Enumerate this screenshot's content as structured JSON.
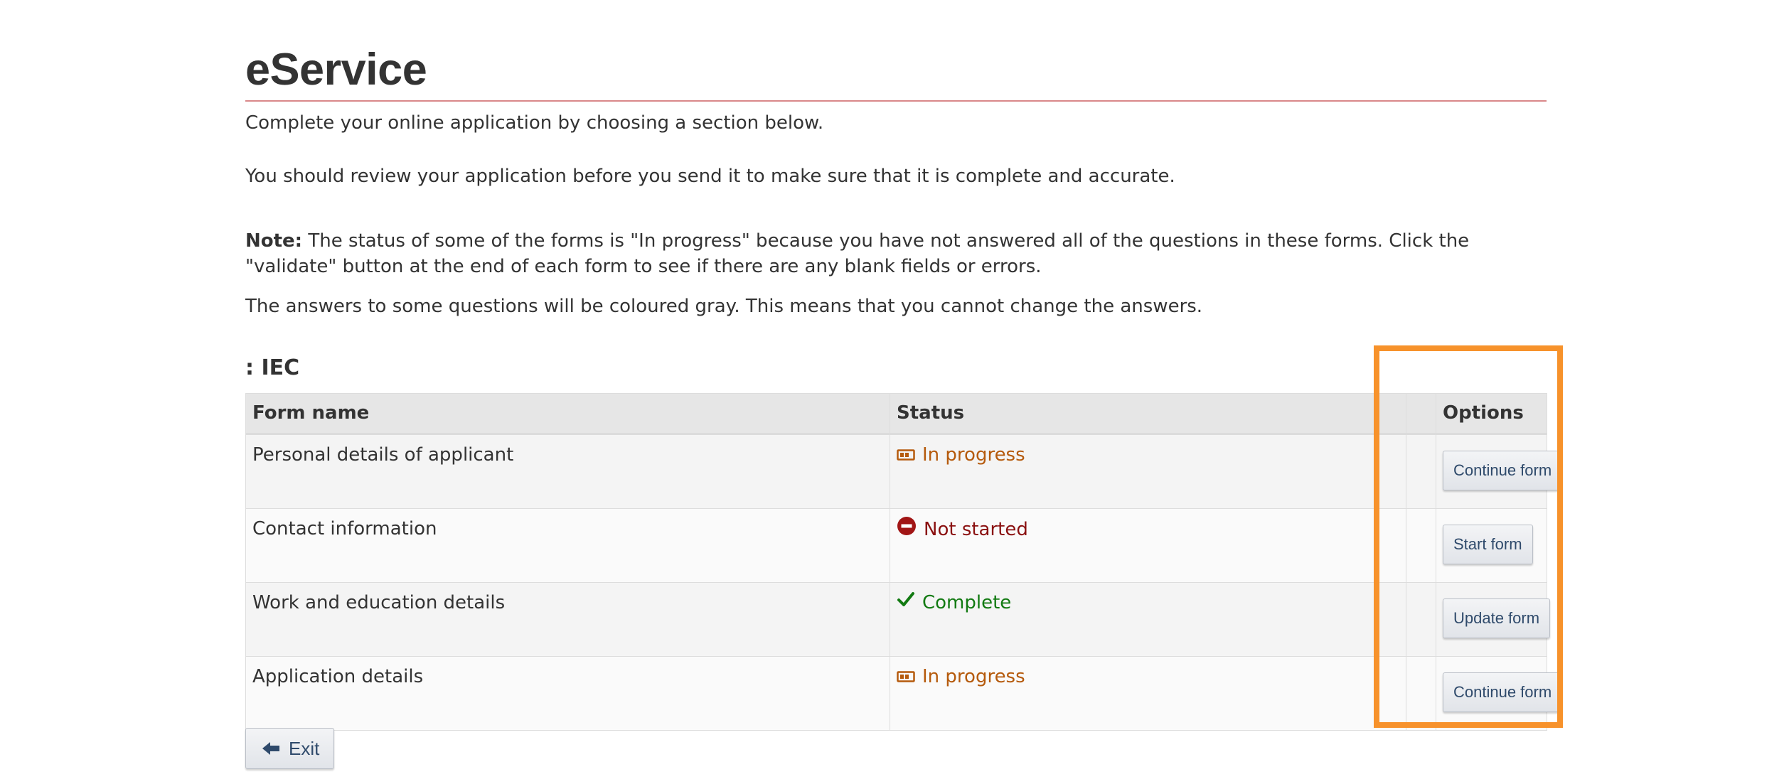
{
  "page": {
    "title": "eService",
    "intro": "Complete your online application by choosing a section below.",
    "review_note": "You should review your application before you send it to make sure that it is complete and accurate.",
    "note_label": "Note:",
    "note_text": " The status of some of the forms is \"In progress\" because you have not answered all of the questions in these forms. Click the \"validate\" button at the end of each form to see if there are any blank fields or errors.",
    "gray_note": "The answers to some questions will be coloured gray. This means that you cannot change the answers."
  },
  "section": {
    "title": ": IEC"
  },
  "table": {
    "headers": {
      "form_name": "Form name",
      "status": "Status",
      "options": "Options"
    },
    "rows": [
      {
        "name": "Personal details of applicant",
        "status": "In progress",
        "status_icon": "in-progress-icon",
        "action": "Continue form"
      },
      {
        "name": "Contact information",
        "status": "Not started",
        "status_icon": "not-started-icon",
        "action": "Start form"
      },
      {
        "name": "Work and education details",
        "status": "Complete",
        "status_icon": "checkmark-icon",
        "action": "Update form"
      },
      {
        "name": "Application details",
        "status": "In progress",
        "status_icon": "in-progress-icon",
        "action": "Continue form"
      }
    ]
  },
  "footer": {
    "exit_label": "Exit",
    "exit_icon": "arrow-left-icon"
  },
  "colors": {
    "in_progress": "#b55a0c",
    "not_started": "#8a1010",
    "complete": "#127a12",
    "highlight": "#f7922b",
    "title_rule": "#d9888a"
  }
}
